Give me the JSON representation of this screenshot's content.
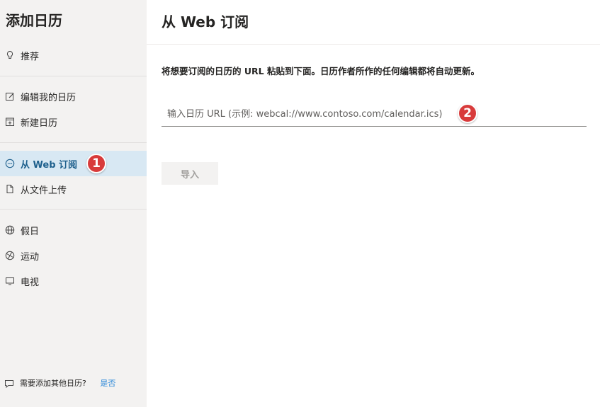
{
  "sidebar": {
    "title": "添加日历",
    "items": [
      {
        "label": "推荐",
        "icon": "lightbulb-icon"
      },
      {
        "label": "编辑我的日历",
        "icon": "edit-icon"
      },
      {
        "label": "新建日历",
        "icon": "calendar-add-icon"
      },
      {
        "label": "从 Web 订阅",
        "icon": "web-link-icon",
        "selected": true
      },
      {
        "label": "从文件上传",
        "icon": "file-icon"
      },
      {
        "label": "假日",
        "icon": "globe-icon"
      },
      {
        "label": "运动",
        "icon": "sports-icon"
      },
      {
        "label": "电视",
        "icon": "tv-icon"
      }
    ],
    "footer": {
      "text": "需要添加其他日历?",
      "link": "是否",
      "icon": "feedback-icon"
    }
  },
  "main": {
    "title": "从 Web 订阅",
    "instruction": "将想要订阅的日历的 URL 粘贴到下面。日历作者所作的任何编辑都将自动更新。",
    "url_input": {
      "placeholder": "输入日历 URL (示例: webcal://www.contoso.com/calendar.ics)",
      "value": ""
    },
    "import_button": "导入"
  },
  "annotations": [
    "1",
    "2"
  ],
  "colors": {
    "accent": "#1d5f8c",
    "selected_bg": "#d8e8f3",
    "badge": "#d83b3b"
  }
}
